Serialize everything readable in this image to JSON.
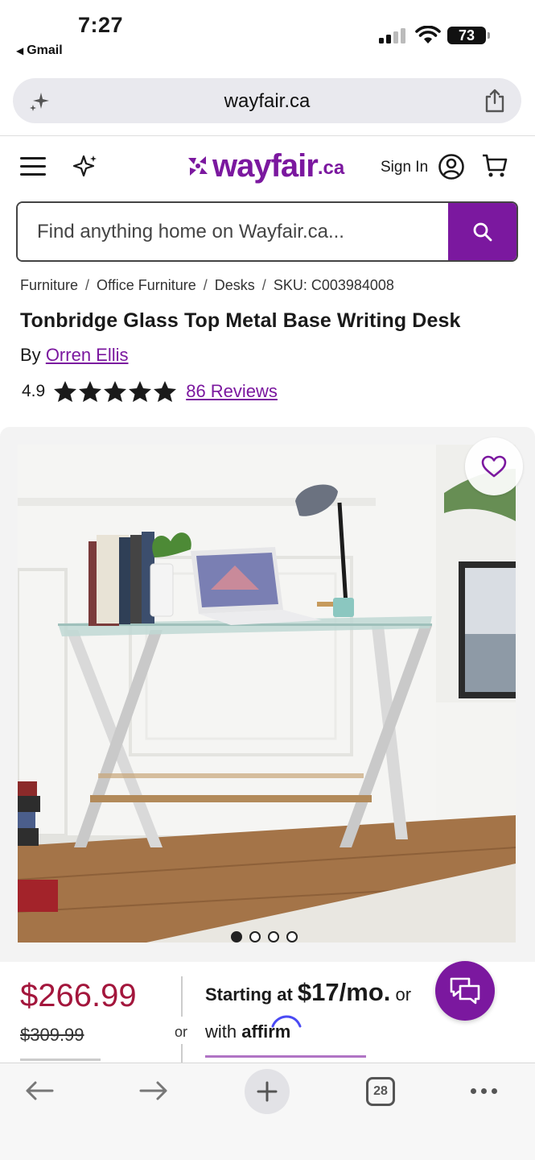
{
  "status_bar": {
    "time": "7:27",
    "back_app": "Gmail",
    "battery": "73"
  },
  "browser": {
    "domain": "wayfair.ca",
    "open_tabs": "28"
  },
  "header": {
    "logo_text": "wayfair",
    "logo_tld": ".ca",
    "sign_in": "Sign In",
    "brand_color": "#7b189f"
  },
  "search": {
    "placeholder": "Find anything home on Wayfair.ca..."
  },
  "breadcrumb": [
    "Furniture",
    "Office Furniture",
    "Desks",
    "SKU: C003984008"
  ],
  "product": {
    "title": "Tonbridge Glass Top Metal Base Writing Desk",
    "by_label": "By",
    "brand": "Orren Ellis",
    "rating": "4.9",
    "stars_filled": 5,
    "reviews": "86 Reviews",
    "image_count": 4,
    "active_image": 1
  },
  "pricing": {
    "price": "$266.99",
    "was_price": "$309.99",
    "or_label": "or",
    "starting_at": "Starting at",
    "monthly": "$17/mo.",
    "or_word": "or",
    "with_label": "with",
    "affirm": "affirm",
    "price_color": "#a3163c"
  }
}
